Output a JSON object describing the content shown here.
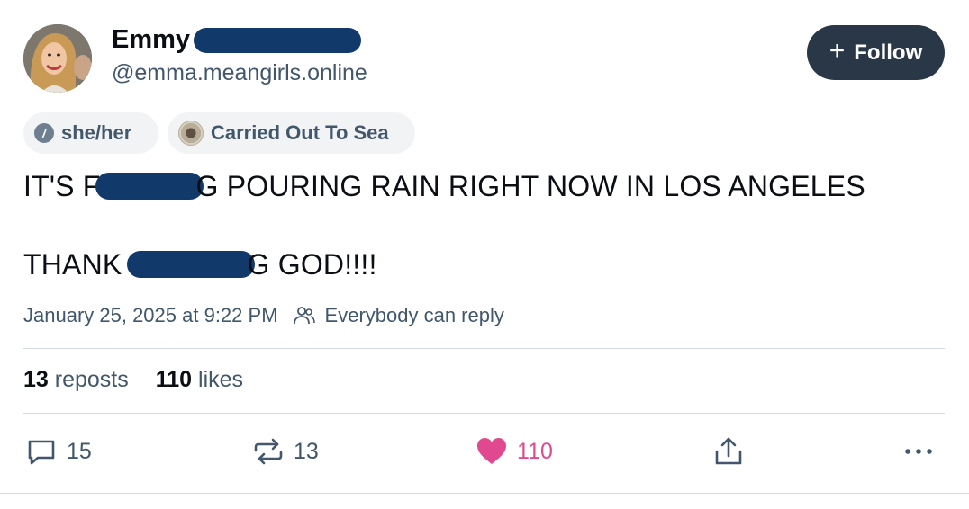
{
  "author": {
    "display_name": "Emmy",
    "handle": "@emma.meangirls.online"
  },
  "follow_button": {
    "label": "Follow",
    "plus": "+"
  },
  "pills": {
    "pronouns": "she/her",
    "pronoun_icon_glyph": "/",
    "label": "Carried Out To Sea"
  },
  "post": {
    "line1_before": "IT'S F",
    "line1_after": "G POURING RAIN RIGHT NOW IN LOS ANGELES",
    "line2_before": "THANK ",
    "line2_after": "G GOD!!!!"
  },
  "meta": {
    "timestamp": "January 25, 2025 at 9:22 PM",
    "reply_setting": "Everybody can reply"
  },
  "stats": {
    "reposts_count": "13",
    "reposts_label": "reposts",
    "likes_count": "110",
    "likes_label": "likes"
  },
  "actions": {
    "reply_count": "15",
    "repost_count": "13",
    "like_count": "110"
  },
  "colors": {
    "accent_like": "#e0488f",
    "follow_bg": "#2a3747",
    "redaction": "#113a6b",
    "muted_text": "#42576c"
  }
}
